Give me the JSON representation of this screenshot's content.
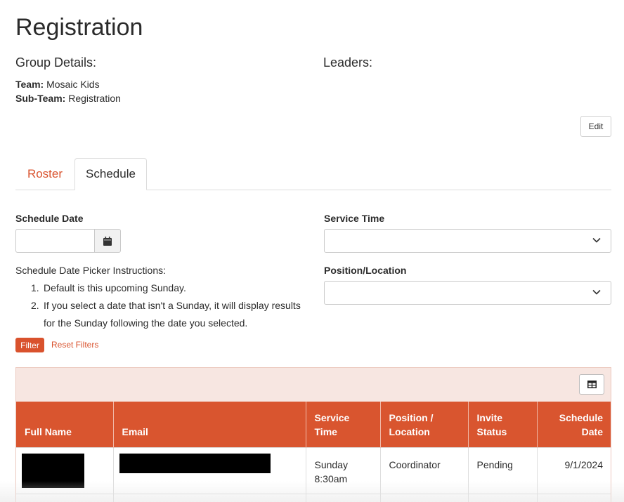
{
  "page": {
    "title": "Registration"
  },
  "group_details": {
    "heading": "Group Details:",
    "team_label": "Team:",
    "team_value": "Mosaic Kids",
    "subteam_label": "Sub-Team:",
    "subteam_value": "Registration"
  },
  "leaders": {
    "heading": "Leaders:"
  },
  "edit_button": "Edit",
  "tabs": [
    {
      "label": "Roster",
      "active": false
    },
    {
      "label": "Schedule",
      "active": true
    }
  ],
  "filters": {
    "schedule_date_label": "Schedule Date",
    "schedule_date_value": "",
    "calendar_icon": "calendar-icon",
    "service_time_label": "Service Time",
    "service_time_value": "",
    "position_label": "Position/Location",
    "position_value": "",
    "instructions_title": "Schedule Date Picker Instructions:",
    "instructions": [
      "Default is this upcoming Sunday.",
      "If you select a date that isn't a Sunday, it will display results for the Sunday following the date you selected."
    ],
    "filter_button": "Filter",
    "reset_link": "Reset Filters"
  },
  "grid": {
    "column_picker_icon": "table-columns-icon",
    "columns": [
      "Full Name",
      "Email",
      "Service Time",
      "Position / Location",
      "Invite Status",
      "Schedule Date"
    ],
    "rows": [
      {
        "full_name": "[redacted]",
        "email": "[redacted]",
        "service_time": "Sunday 8:30am",
        "position": "Coordinator",
        "invite_status": "Pending",
        "schedule_date": "9/1/2024"
      }
    ]
  },
  "colors": {
    "accent": "#d9522d",
    "header_band": "#f7e6e1"
  }
}
